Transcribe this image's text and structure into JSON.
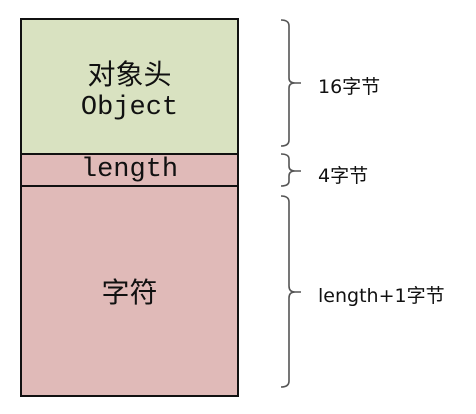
{
  "segments": [
    {
      "title_cn": "对象头",
      "title_en": "Object",
      "size_label": "16字节",
      "color": "#d9e2c1"
    },
    {
      "title_en": "length",
      "size_label": "4字节",
      "color": "#e0bab8"
    },
    {
      "title_cn": "字符",
      "size_label": "length+1字节",
      "color": "#e0bab8"
    }
  ]
}
